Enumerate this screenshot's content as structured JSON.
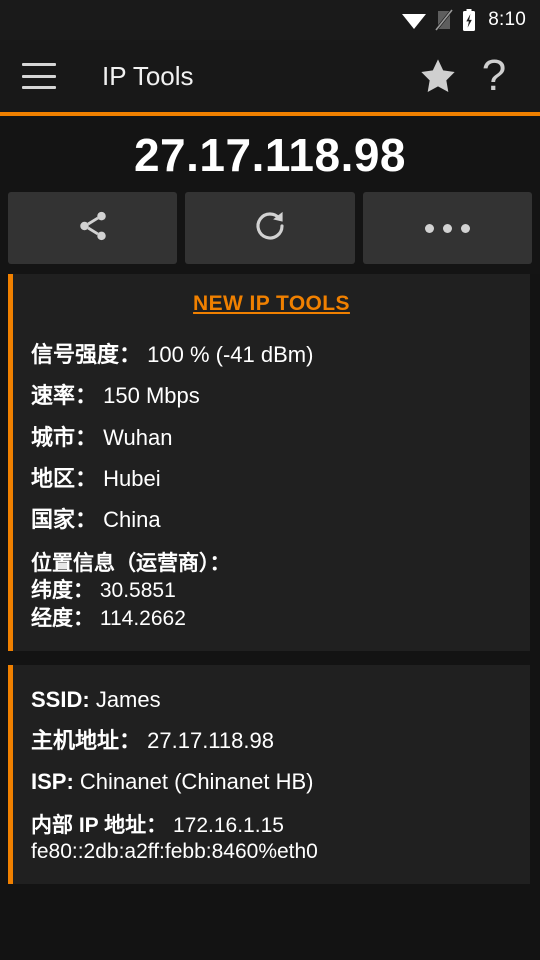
{
  "statusbar": {
    "wifi_icon": "wifi-icon",
    "signal_off_icon": "signal-no-sim-icon",
    "battery_icon": "battery-charging-icon",
    "time": "8:10"
  },
  "toolbar": {
    "menu_icon": "hamburger-menu-icon",
    "title": "IP Tools",
    "favorite_icon": "star-icon",
    "help_label": "?",
    "accent_color": "#f08000"
  },
  "ip_header": {
    "public_ip": "27.17.118.98"
  },
  "actions": {
    "share_icon": "share-icon",
    "refresh_icon": "refresh-icon",
    "more_icon": "more-options-icon"
  },
  "info_card": {
    "promo_link": "NEW IP TOOLS",
    "rows": [
      {
        "label": "信号强度：",
        "value": "100 % (-41 dBm)"
      },
      {
        "label": "速率：",
        "value": "150 Mbps"
      },
      {
        "label": "城市：",
        "value": "Wuhan"
      },
      {
        "label": "地区：",
        "value": "Hubei"
      },
      {
        "label": "国家：",
        "value": "China"
      }
    ],
    "location_block": {
      "title": "位置信息（运营商）：",
      "latitude_label": "纬度：",
      "latitude_value": "30.5851",
      "longitude_label": "经度：",
      "longitude_value": "114.2662"
    }
  },
  "network_card": {
    "ssid_label": "SSID:",
    "ssid_value": "James",
    "host_label": "主机地址：",
    "host_value": "27.17.118.98",
    "isp_label": "ISP:",
    "isp_value": "Chinanet (Chinanet HB)",
    "internal_ip_label": "内部 IP 地址：",
    "internal_ip_value": "172.16.1.15",
    "internal_ipv6_value": "fe80::2db:a2ff:febb:8460%eth0"
  }
}
